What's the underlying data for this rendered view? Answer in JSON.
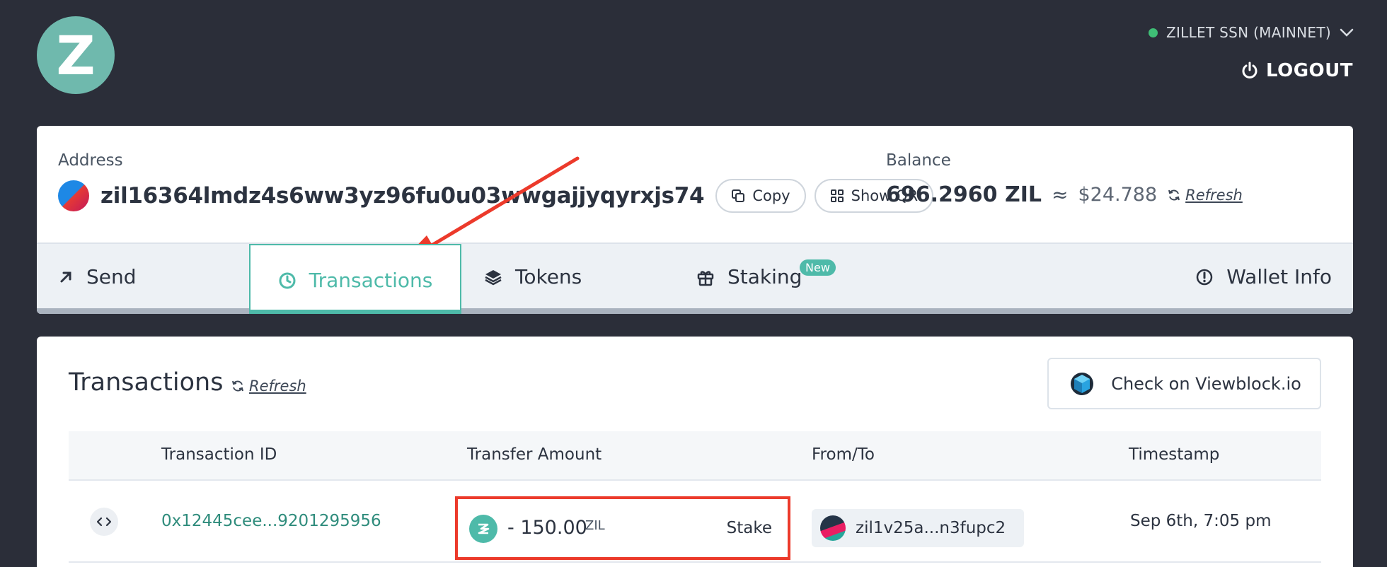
{
  "header": {
    "logo_letter": "Z",
    "network_label": "ZILLET SSN (MAINNET)",
    "network_status_color": "#3fbf76",
    "logout_label": "LOGOUT"
  },
  "account": {
    "address_label": "Address",
    "address": "zil16364lmdz4s6ww3yz96fu0u03wwgajjyqyrxjs74",
    "copy_label": "Copy",
    "show_qr_label": "Show QR",
    "balance_label": "Balance",
    "balance_zil": "696.2960 ZIL",
    "approx_symbol": "≈",
    "balance_usd": "$24.788",
    "refresh_label": "Refresh"
  },
  "tabs": {
    "send": "Send",
    "transactions": "Transactions",
    "tokens": "Tokens",
    "staking": "Staking",
    "staking_badge": "New",
    "wallet_info": "Wallet Info",
    "active": "transactions"
  },
  "transactions": {
    "title": "Transactions",
    "refresh_label": "Refresh",
    "viewblock_label": "Check on Viewblock.io",
    "columns": [
      "Transaction ID",
      "Transfer Amount",
      "From/To",
      "Timestamp"
    ],
    "rows": [
      {
        "id": "0x12445cee...9201295956",
        "amount": "- 150.00",
        "unit": "ZIL",
        "type": "Stake",
        "from_to": "zil1v25a...n3fupc2",
        "timestamp": "Sep 6th, 7:05 pm"
      }
    ]
  },
  "colors": {
    "accent": "#4ebaa9",
    "background": "#2b2e39",
    "highlight_red": "#ec3a2b"
  }
}
